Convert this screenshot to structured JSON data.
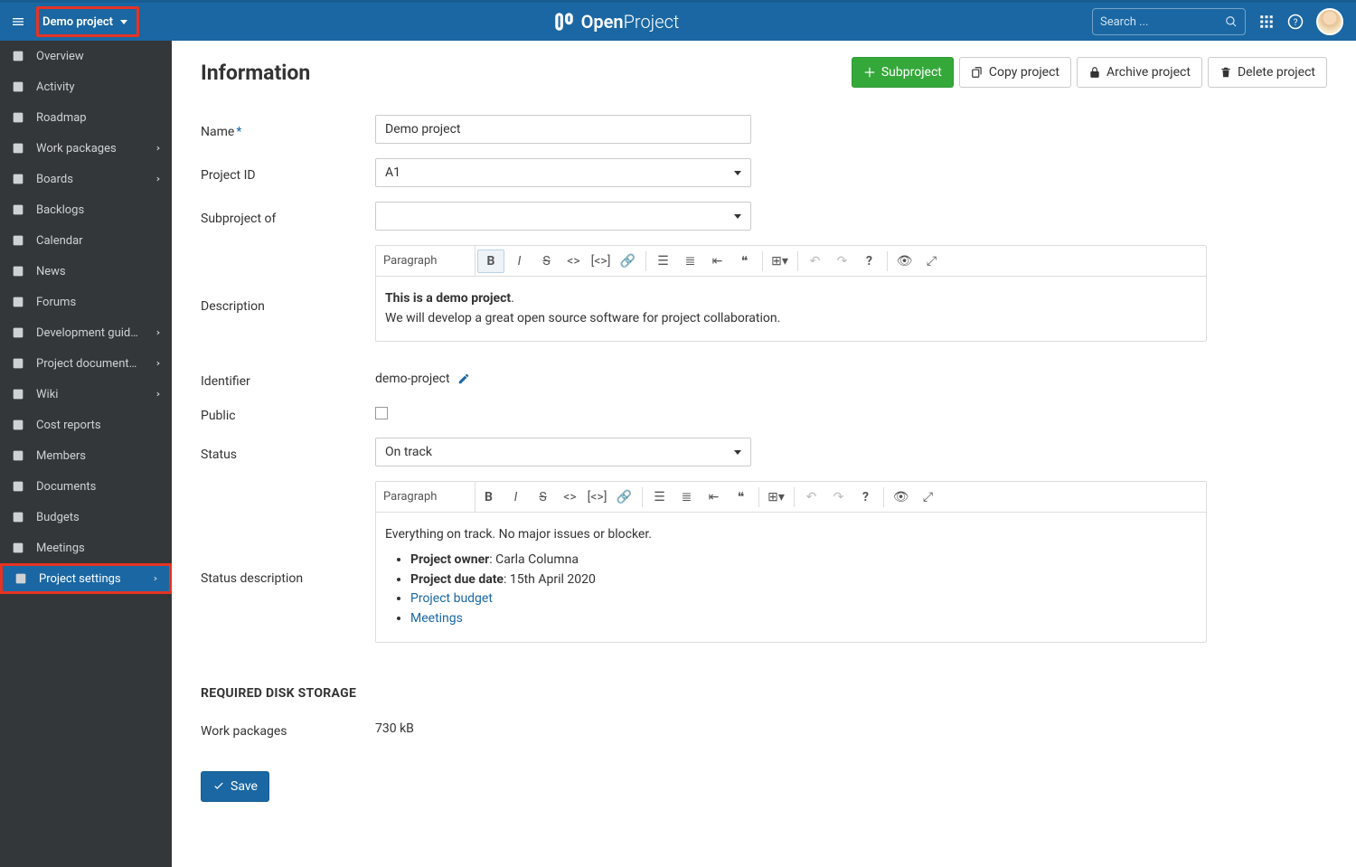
{
  "header": {
    "project_name": "Demo project",
    "brand_bold": "Open",
    "brand_light": "Project",
    "search_placeholder": "Search ..."
  },
  "sidebar": [
    {
      "label": "Overview",
      "icon": "info",
      "arrow": false
    },
    {
      "label": "Activity",
      "icon": "check",
      "arrow": false
    },
    {
      "label": "Roadmap",
      "icon": "tag",
      "arrow": false
    },
    {
      "label": "Work packages",
      "icon": "wp",
      "arrow": true
    },
    {
      "label": "Boards",
      "icon": "boards",
      "arrow": true
    },
    {
      "label": "Backlogs",
      "icon": "backlogs",
      "arrow": false
    },
    {
      "label": "Calendar",
      "icon": "calendar",
      "arrow": false
    },
    {
      "label": "News",
      "icon": "news",
      "arrow": false
    },
    {
      "label": "Forums",
      "icon": "forum",
      "arrow": false
    },
    {
      "label": "Development guideli...",
      "icon": "book",
      "arrow": true
    },
    {
      "label": "Project documentati...",
      "icon": "book",
      "arrow": true
    },
    {
      "label": "Wiki",
      "icon": "book",
      "arrow": true
    },
    {
      "label": "Cost reports",
      "icon": "cost",
      "arrow": false
    },
    {
      "label": "Members",
      "icon": "members",
      "arrow": false
    },
    {
      "label": "Documents",
      "icon": "doc",
      "arrow": false
    },
    {
      "label": "Budgets",
      "icon": "budget",
      "arrow": false
    },
    {
      "label": "Meetings",
      "icon": "meeting",
      "arrow": false
    },
    {
      "label": "Project settings",
      "icon": "gears",
      "arrow": true,
      "active": true
    }
  ],
  "page": {
    "title": "Information",
    "actions": {
      "subproject": "Subproject",
      "copy": "Copy project",
      "archive": "Archive project",
      "delete": "Delete project"
    },
    "labels": {
      "name": "Name",
      "project_id": "Project ID",
      "subproject_of": "Subproject of",
      "description": "Description",
      "identifier": "Identifier",
      "public": "Public",
      "status": "Status",
      "status_desc": "Status description"
    },
    "values": {
      "name": "Demo project",
      "project_id": "A1",
      "subproject_of": "",
      "identifier": "demo-project",
      "status": "On track"
    },
    "editor_style_label": "Paragraph",
    "description_body": {
      "line1_bold": "This is a demo project",
      "line1_rest": ".",
      "line2": "We will develop a great open source software for project collaboration."
    },
    "status_body": {
      "intro": "Everything on track. No major issues or blocker.",
      "owner_label": "Project owner",
      "owner_value": ": Carla Columna",
      "due_label": "Project due date",
      "due_value": ": 15th April 2020",
      "link1": "Project budget",
      "link2": "Meetings"
    },
    "storage": {
      "heading": "REQUIRED DISK STORAGE",
      "wp_label": "Work packages",
      "wp_value": "730 kB"
    },
    "save": "Save"
  }
}
